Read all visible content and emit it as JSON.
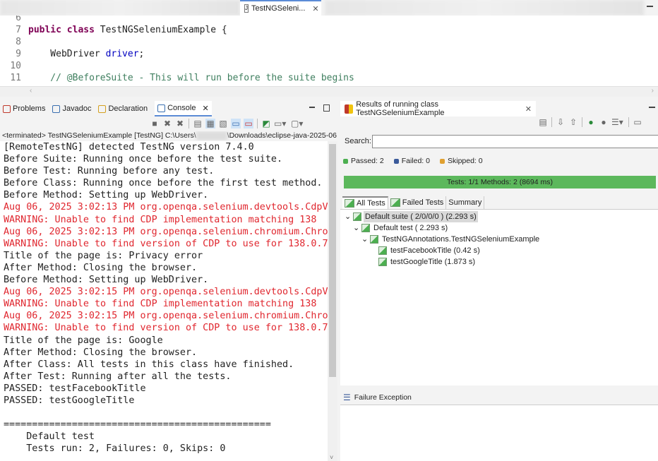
{
  "editor_tab": {
    "title": "TestNGSeleni...",
    "icon": "java-file-icon"
  },
  "code_lines": [
    {
      "num": "6",
      "parts": []
    },
    {
      "num": "7",
      "parts": [
        {
          "t": "public class ",
          "c": "kw"
        },
        {
          "t": "TestNGSeleniumExample {",
          "c": ""
        }
      ]
    },
    {
      "num": "8",
      "parts": []
    },
    {
      "num": "9",
      "parts": [
        {
          "t": "    WebDriver ",
          "c": ""
        },
        {
          "t": "driver",
          "c": "fld"
        },
        {
          "t": ";",
          "c": ""
        }
      ]
    },
    {
      "num": "10",
      "parts": []
    },
    {
      "num": "11",
      "parts": [
        {
          "t": "    // @BeforeSuite - This will run before the suite begins",
          "c": "cm"
        }
      ]
    }
  ],
  "console_panel": {
    "tabs": [
      {
        "label": "Problems",
        "icon": "problems-icon"
      },
      {
        "label": "Javadoc",
        "icon": "at-icon"
      },
      {
        "label": "Declaration",
        "icon": "declaration-icon"
      },
      {
        "label": "Console",
        "icon": "console-icon",
        "active": true
      }
    ],
    "terminated_prefix": "<terminated> TestNGSeleniumExample [TestNG] C:\\Users\\",
    "terminated_suffix": "\\Downloads\\eclipse-java-2025-06",
    "lines": [
      {
        "text": "[RemoteTestNG] detected TestNG version 7.4.0",
        "err": false
      },
      {
        "text": "Before Suite: Running once before the test suite.",
        "err": false
      },
      {
        "text": "Before Test: Running before any test.",
        "err": false
      },
      {
        "text": "Before Class: Running once before the first test method.",
        "err": false
      },
      {
        "text": "Before Method: Setting up WebDriver.",
        "err": false
      },
      {
        "text": "Aug 06, 2025 3:02:13 PM org.openqa.selenium.devtools.CdpV",
        "err": true
      },
      {
        "text": "WARNING: Unable to find CDP implementation matching 138",
        "err": true
      },
      {
        "text": "Aug 06, 2025 3:02:13 PM org.openqa.selenium.chromium.Chro",
        "err": true
      },
      {
        "text": "WARNING: Unable to find version of CDP to use for 138.0.7",
        "err": true
      },
      {
        "text": "Title of the page is: Privacy error",
        "err": false
      },
      {
        "text": "After Method: Closing the browser.",
        "err": false
      },
      {
        "text": "Before Method: Setting up WebDriver.",
        "err": false
      },
      {
        "text": "Aug 06, 2025 3:02:15 PM org.openqa.selenium.devtools.CdpV",
        "err": true
      },
      {
        "text": "WARNING: Unable to find CDP implementation matching 138",
        "err": true
      },
      {
        "text": "Aug 06, 2025 3:02:15 PM org.openqa.selenium.chromium.Chro",
        "err": true
      },
      {
        "text": "WARNING: Unable to find version of CDP to use for 138.0.7",
        "err": true
      },
      {
        "text": "Title of the page is: Google",
        "err": false
      },
      {
        "text": "After Method: Closing the browser.",
        "err": false
      },
      {
        "text": "After Class: All tests in this class have finished.",
        "err": false
      },
      {
        "text": "After Test: Running after all the tests.",
        "err": false
      },
      {
        "text": "PASSED: testFacebookTitle",
        "err": false
      },
      {
        "text": "PASSED: testGoogleTitle",
        "err": false
      },
      {
        "text": "",
        "err": false
      },
      {
        "text": "===============================================",
        "err": false
      },
      {
        "text": "    Default test",
        "err": false
      },
      {
        "text": "    Tests run: 2, Failures: 0, Skips: 0",
        "err": false
      }
    ]
  },
  "testng_panel": {
    "title": "Results of running class TestNGSeleniumExample",
    "search_label": "Search:",
    "search_value": "",
    "passed": "Passed: 2",
    "failed": "Failed: 0",
    "skipped": "Skipped: 0",
    "progress_text": "Tests: 1/1  Methods: 2 (8694 ms)",
    "progress_percent": 100,
    "progress_color": "#5cb85c",
    "tabs": [
      "All Tests",
      "Failed Tests",
      "Summary"
    ],
    "tree": [
      {
        "label": "Default suite ( 2/0/0/0 ) (2.293 s)",
        "level": 0,
        "expanded": true,
        "selected": true
      },
      {
        "label": "Default test ( 2.293 s)",
        "level": 1,
        "expanded": true
      },
      {
        "label": "TestNGAnnotations.TestNGSeleniumExample",
        "level": 2,
        "expanded": true
      },
      {
        "label": "testFacebookTitle  (0.42 s)",
        "level": 3
      },
      {
        "label": "testGoogleTitle  (1.873 s)",
        "level": 3
      }
    ],
    "failure_label": "Failure Exception"
  }
}
